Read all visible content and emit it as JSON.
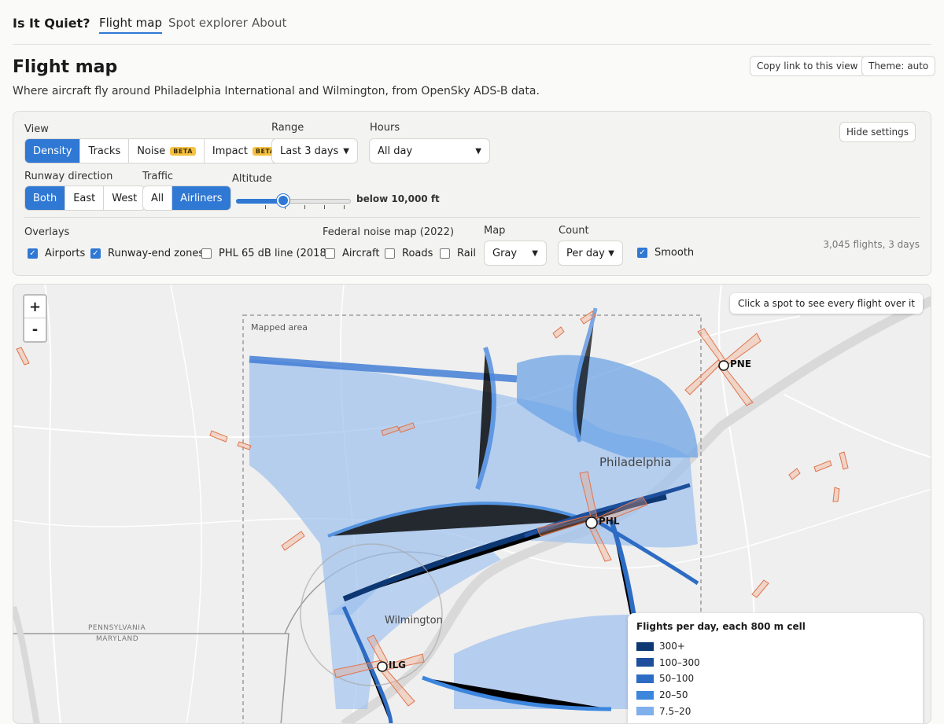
{
  "nav": {
    "brand": "Is It Quiet?",
    "links": [
      "Flight map",
      "Spot explorer",
      "About"
    ]
  },
  "header": {
    "title": "Flight map",
    "subtitle": "Where aircraft fly around Philadelphia International and Wilmington, from OpenSky ADS-B data.",
    "copy_link": "Copy link to this view",
    "theme": "Theme: auto"
  },
  "settings": {
    "hide_label": "Hide settings",
    "view": {
      "label": "View",
      "options": [
        "Density",
        "Tracks",
        "Noise",
        "Impact"
      ],
      "beta_badge": "BETA",
      "selected": "Density"
    },
    "range": {
      "label": "Range",
      "value": "Last 3 days"
    },
    "hours": {
      "label": "Hours",
      "value": "All day"
    },
    "runway": {
      "label": "Runway direction",
      "options": [
        "Both",
        "East",
        "West"
      ],
      "selected": "Both"
    },
    "traffic": {
      "label": "Traffic",
      "options": [
        "All",
        "Airliners"
      ],
      "selected": "Airliners"
    },
    "altitude": {
      "label": "Altitude",
      "value_text": "below 10,000 ft",
      "slider_fraction": 0.4
    },
    "overlays": {
      "label": "Overlays",
      "airports": "Airports",
      "runway_zones": "Runway-end zones",
      "phl_line": "PHL 65 dB line (2018)",
      "airports_checked": true,
      "runway_zones_checked": true,
      "phl_line_checked": false
    },
    "federal": {
      "label": "Federal noise map (2022)",
      "aircraft": "Aircraft",
      "roads": "Roads",
      "rail": "Rail"
    },
    "map_style": {
      "label": "Map",
      "value": "Gray"
    },
    "count": {
      "label": "Count",
      "value": "Per day"
    },
    "smooth": {
      "label": "Smooth",
      "checked": true
    },
    "summary": "3,045 flights, 3 days"
  },
  "map": {
    "zoom_in": "+",
    "zoom_out": "-",
    "tip": "Click a spot to see every flight over it",
    "mapped_area": "Mapped area",
    "cities": {
      "philadelphia": "Philadelphia",
      "wilmington": "Wilmington"
    },
    "state_line": {
      "upper": "PENNSYLVANIA",
      "lower": "MARYLAND"
    },
    "airports": [
      "PNE",
      "PHL",
      "ILG"
    ],
    "legend": {
      "title": "Flights per day, each 800 m cell",
      "items": [
        {
          "label": "300+",
          "color": "#0d3772"
        },
        {
          "label": "100–300",
          "color": "#1d4f9c"
        },
        {
          "label": "50–100",
          "color": "#2d6cc4"
        },
        {
          "label": "20–50",
          "color": "#3d86de"
        },
        {
          "label": "7.5–20",
          "color": "#7fb0ec"
        }
      ]
    }
  },
  "colors": {
    "accent": "#2f78d4",
    "beta": "#f5c242",
    "zone": "#f1a27e"
  }
}
